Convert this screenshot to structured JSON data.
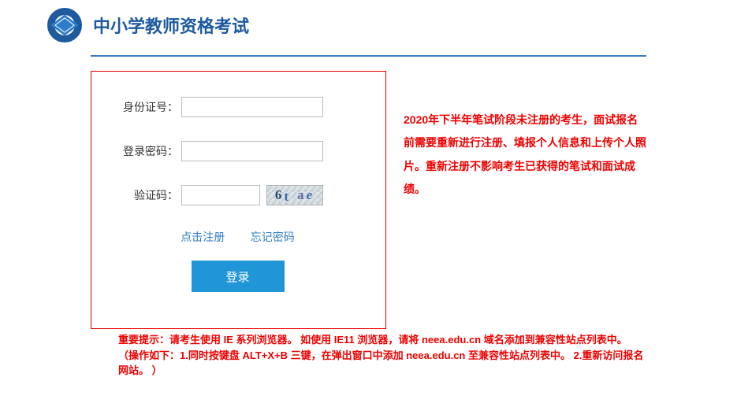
{
  "header": {
    "site_title": "中小学教师资格考试"
  },
  "form": {
    "id_label": "身份证号：",
    "id_value": "",
    "password_label": "登录密码：",
    "password_value": "",
    "captcha_label": "验证码：",
    "captcha_value": "",
    "captcha_text": "6t a e",
    "register_link": "点击注册",
    "forgot_link": "忘记密码",
    "login_button": "登录"
  },
  "side_notice": "2020年下半年笔试阶段未注册的考生，面试报名前需要重新进行注册、填报个人信息和上传个人照片。重新注册不影响考生已获得的笔试和面试成绩。",
  "footer": {
    "line1": "重要提示：请考生使用 IE 系列浏览器。 如使用 IE11 浏览器，请将 neea.edu.cn 域名添加到兼容性站点列表中。",
    "line2": "（操作如下：1.同时按键盘 ALT+X+B 三键，在弹出窗口中添加 neea.edu.cn 至兼容性站点列表中。 2.重新访问报名网站。 ）"
  }
}
